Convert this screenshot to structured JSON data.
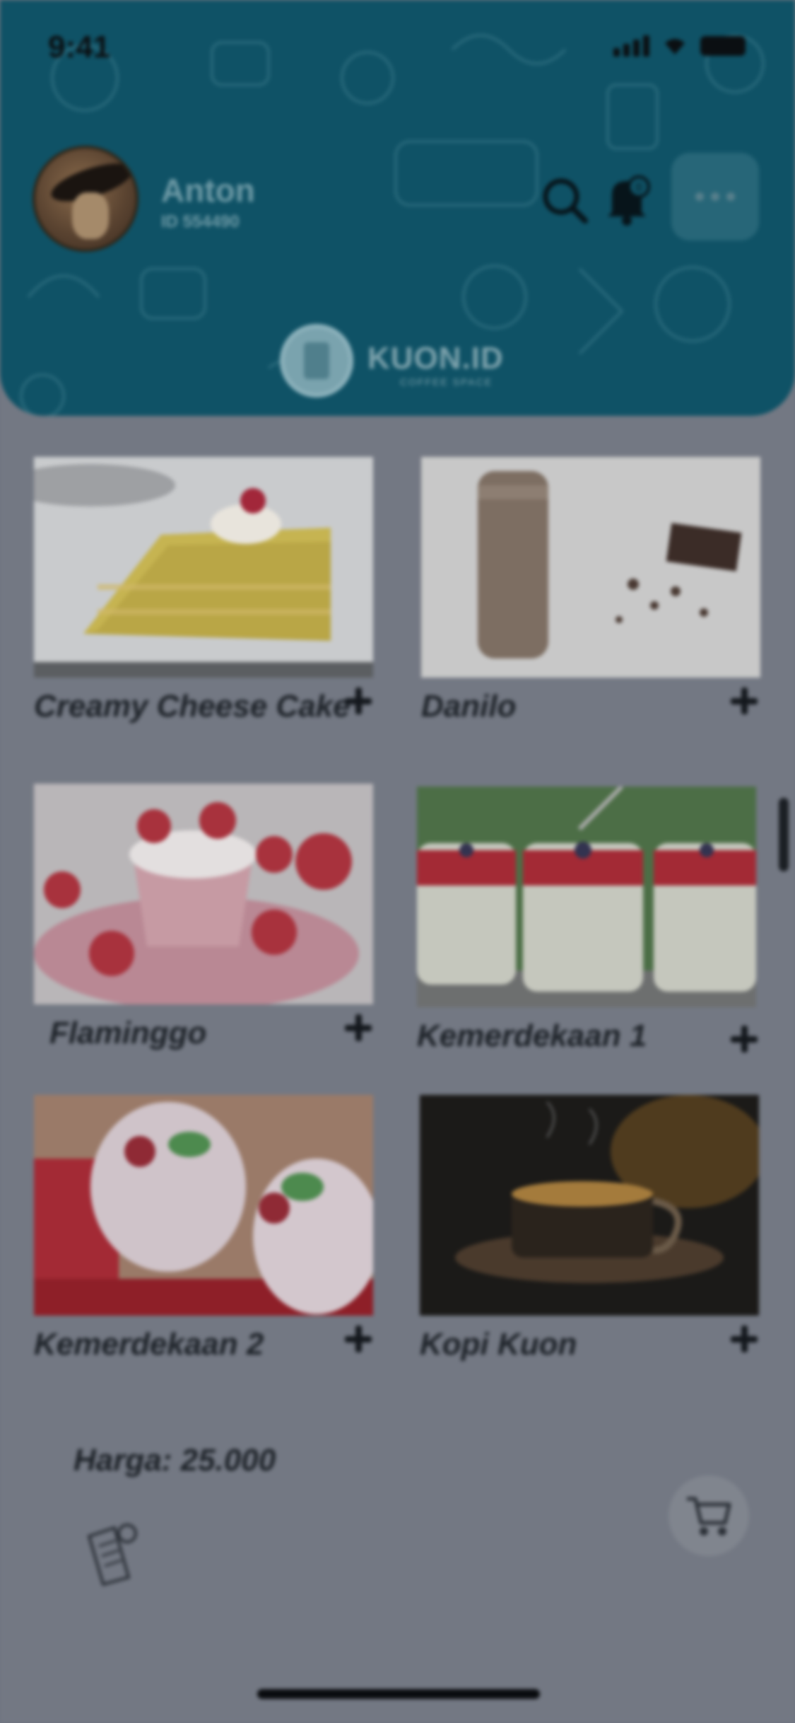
{
  "status_bar": {
    "time": "9:41"
  },
  "user": {
    "name": "Anton",
    "id": "ID 554490"
  },
  "header": {
    "logo_text": "KUON.ID",
    "logo_subtitle": "COFFEE SPACE",
    "notification_count": "0"
  },
  "products": [
    {
      "name": "Creamy Cheese Cake"
    },
    {
      "name": "Danilo"
    },
    {
      "name": "Flaminggo"
    },
    {
      "name": "Kemerdekaan 1"
    },
    {
      "name": "Kemerdekaan 2"
    },
    {
      "name": "Kopi Kuon"
    }
  ],
  "footer": {
    "price": "Harga: 25.000"
  },
  "colors": {
    "header": "#0f5266",
    "background": "#737883",
    "text": "#1d2228"
  }
}
